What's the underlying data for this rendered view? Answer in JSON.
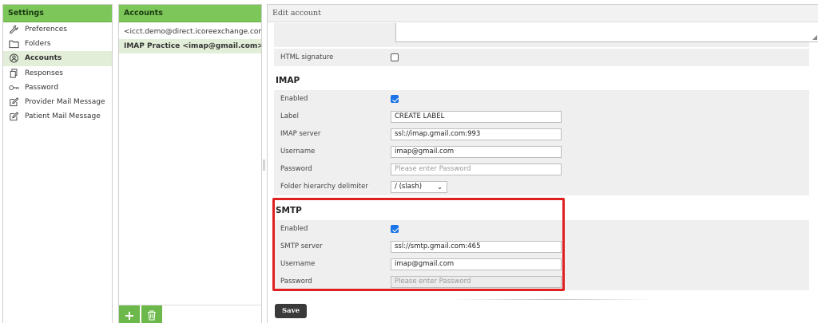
{
  "settings": {
    "title": "Settings",
    "items": [
      {
        "label": "Preferences",
        "icon": "wrench-icon"
      },
      {
        "label": "Folders",
        "icon": "folder-icon"
      },
      {
        "label": "Accounts",
        "icon": "at-icon"
      },
      {
        "label": "Responses",
        "icon": "copy-icon"
      },
      {
        "label": "Password",
        "icon": "key-icon"
      },
      {
        "label": "Provider Mail Message",
        "icon": "edit-icon"
      },
      {
        "label": "Patient Mail Message",
        "icon": "edit-icon"
      }
    ],
    "active_index": 2
  },
  "accounts": {
    "title": "Accounts",
    "items": [
      {
        "label": "<icct.demo@direct.icoreexchange.com>"
      },
      {
        "label": "IMAP Practice <imap@gmail.com>"
      }
    ],
    "active_index": 1,
    "add_label": "+",
    "delete_icon": "trash-icon"
  },
  "edit": {
    "title": "Edit account",
    "html_signature": {
      "label": "HTML signature",
      "checked": false
    },
    "imap": {
      "title": "IMAP",
      "enabled_label": "Enabled",
      "enabled": true,
      "label_label": "Label",
      "label_value": "CREATE LABEL",
      "server_label": "IMAP server",
      "server_value": "ssl://imap.gmail.com:993",
      "username_label": "Username",
      "username_value": "imap@gmail.com",
      "password_label": "Password",
      "password_placeholder": "Please enter Password",
      "delimiter_label": "Folder hierarchy delimiter",
      "delimiter_value": "/ (slash)"
    },
    "smtp": {
      "title": "SMTP",
      "enabled_label": "Enabled",
      "enabled": true,
      "server_label": "SMTP server",
      "server_value": "ssl://smtp.gmail.com:465",
      "username_label": "Username",
      "username_value": "imap@gmail.com",
      "password_label": "Password",
      "password_placeholder": "Please enter Password"
    },
    "save_label": "Save"
  },
  "colors": {
    "accent_green": "#7cc65a",
    "highlight_red": "#e02020",
    "checkbox_blue": "#1a73e8"
  }
}
